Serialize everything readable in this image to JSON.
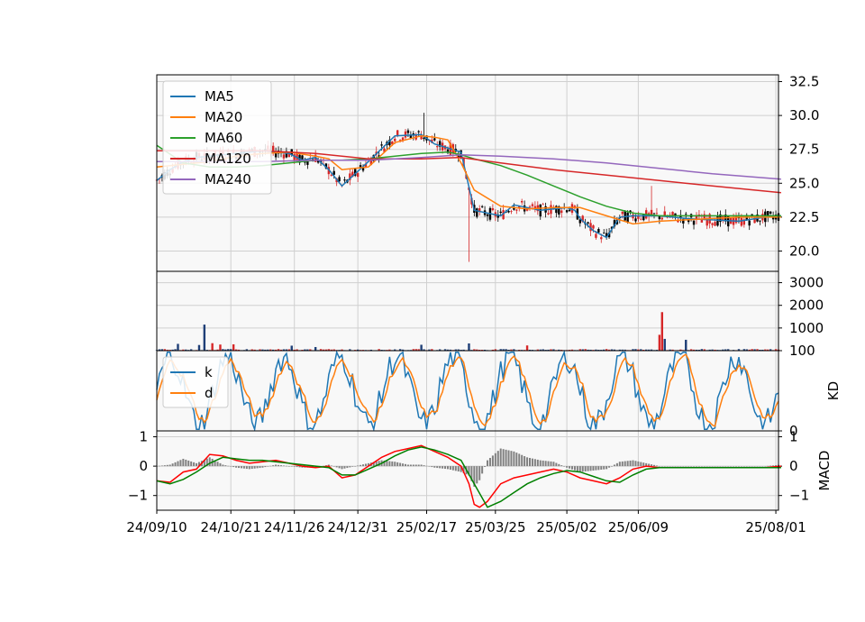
{
  "chart_data": [
    {
      "panel": "price",
      "type": "candlestick+line",
      "y_ticks": [
        "20.0",
        "22.5",
        "25.0",
        "27.5",
        "30.0",
        "32.5"
      ],
      "ylim": [
        18.5,
        33.0
      ],
      "grid": true,
      "legend_position": "top-left",
      "legend": [
        "MA5",
        "MA20",
        "MA60",
        "MA120",
        "MA240"
      ],
      "colors": {
        "MA5": "#1f77b4",
        "MA20": "#ff7f0e",
        "MA60": "#2ca02c",
        "MA120": "#d62728",
        "MA240": "#9467bd",
        "up": "#d62728",
        "down": "#000000"
      },
      "series": [
        {
          "name": "MA5",
          "x": [
            0,
            5,
            10,
            15,
            20,
            25,
            30,
            40,
            50,
            55,
            60,
            65,
            70,
            80,
            90,
            100,
            105,
            110,
            115,
            120,
            130,
            135,
            140,
            145,
            150,
            155,
            158,
            160,
            165,
            170,
            175,
            180,
            190,
            200,
            210,
            220,
            230,
            236
          ],
          "y": [
            25.2,
            26.0,
            26.6,
            26.9,
            27.0,
            27.1,
            27.2,
            27.4,
            27.2,
            26.7,
            26.9,
            26.0,
            24.8,
            26.6,
            28.5,
            28.6,
            27.9,
            27.6,
            27.3,
            23.0,
            22.6,
            23.4,
            23.2,
            23.0,
            23.1,
            23.2,
            23.0,
            22.4,
            21.5,
            21.0,
            22.5,
            22.6,
            22.6,
            22.4,
            22.3,
            22.2,
            22.5,
            22.6
          ]
        },
        {
          "name": "MA20",
          "x": [
            0,
            10,
            20,
            30,
            40,
            50,
            60,
            65,
            70,
            80,
            90,
            100,
            105,
            110,
            115,
            120,
            130,
            140,
            150,
            160,
            170,
            180,
            190,
            200,
            210,
            220,
            230,
            236
          ],
          "y": [
            26.2,
            26.4,
            26.6,
            27.0,
            27.2,
            27.3,
            27.0,
            26.8,
            26.0,
            26.2,
            28.0,
            28.5,
            28.4,
            28.2,
            26.5,
            24.5,
            23.3,
            23.1,
            23.2,
            23.2,
            22.6,
            22.0,
            22.2,
            22.3,
            22.4,
            22.5,
            22.5,
            22.5
          ]
        },
        {
          "name": "MA60",
          "x": [
            0,
            10,
            20,
            30,
            40,
            50,
            60,
            70,
            80,
            90,
            100,
            110,
            115,
            120,
            130,
            140,
            150,
            160,
            170,
            180,
            190,
            200,
            210,
            220,
            230,
            236
          ],
          "y": [
            27.8,
            26.5,
            26.2,
            26.2,
            26.3,
            26.5,
            26.7,
            26.7,
            26.8,
            27.0,
            27.2,
            27.3,
            27.1,
            26.8,
            26.3,
            25.6,
            24.8,
            24.0,
            23.3,
            22.8,
            22.6,
            22.6,
            22.6,
            22.6,
            22.6,
            22.6
          ]
        },
        {
          "name": "MA120",
          "x": [
            0,
            20,
            40,
            60,
            80,
            100,
            115,
            130,
            150,
            170,
            190,
            210,
            236
          ],
          "y": [
            27.4,
            27.4,
            27.4,
            27.2,
            26.8,
            26.8,
            26.9,
            26.5,
            26.0,
            25.6,
            25.2,
            24.8,
            24.3
          ]
        },
        {
          "name": "MA240",
          "x": [
            0,
            20,
            40,
            60,
            80,
            100,
            115,
            130,
            150,
            170,
            190,
            210,
            236
          ],
          "y": [
            26.6,
            26.6,
            26.6,
            26.7,
            26.7,
            26.9,
            27.1,
            27.0,
            26.8,
            26.5,
            26.1,
            25.7,
            25.3
          ]
        }
      ]
    },
    {
      "panel": "volume",
      "type": "bar",
      "y_ticks": [
        "1000",
        "2000",
        "3000"
      ],
      "ylim": [
        0,
        3500
      ],
      "grid": true
    },
    {
      "panel": "kd",
      "type": "line",
      "ylabel": "KD",
      "y_ticks": [
        "0",
        "100"
      ],
      "ylim": [
        0,
        100
      ],
      "grid": true,
      "legend_position": "top-left",
      "legend": [
        "k",
        "d"
      ],
      "colors": {
        "k": "#1f77b4",
        "d": "#ff7f0e"
      }
    },
    {
      "panel": "macd",
      "type": "line+bar",
      "ylabel": "MACD",
      "y_ticks_left": [
        "1",
        "0",
        "−1"
      ],
      "y_ticks_right": [
        "1",
        "0",
        "−1"
      ],
      "ylim": [
        -1.5,
        1.2
      ],
      "grid": true,
      "colors": {
        "dif": "#ff0000",
        "signal": "#008000",
        "hist": "#808080"
      },
      "series": [
        {
          "name": "",
          "color": "#ff0000",
          "x": [
            0,
            5,
            10,
            15,
            20,
            25,
            30,
            35,
            40,
            45,
            50,
            55,
            60,
            65,
            70,
            75,
            80,
            85,
            90,
            95,
            100,
            105,
            110,
            115,
            118,
            120,
            122,
            125,
            130,
            135,
            140,
            145,
            150,
            155,
            160,
            165,
            170,
            175,
            180,
            185,
            190,
            195,
            200,
            205,
            210,
            215,
            220,
            225,
            230,
            236
          ],
          "y": [
            -0.5,
            -0.55,
            -0.2,
            -0.1,
            0.4,
            0.35,
            0.2,
            0.1,
            0.15,
            0.2,
            0.1,
            0.0,
            -0.05,
            0.0,
            -0.4,
            -0.3,
            0.0,
            0.3,
            0.5,
            0.6,
            0.7,
            0.5,
            0.3,
            0.0,
            -0.6,
            -1.3,
            -1.4,
            -1.2,
            -0.6,
            -0.4,
            -0.3,
            -0.2,
            -0.1,
            -0.2,
            -0.4,
            -0.5,
            -0.6,
            -0.4,
            -0.1,
            0.0,
            -0.05,
            -0.05,
            -0.05,
            -0.05,
            -0.05,
            -0.05,
            -0.05,
            -0.05,
            -0.05,
            0.0
          ]
        },
        {
          "name": "",
          "color": "#008000",
          "x": [
            0,
            5,
            10,
            15,
            20,
            25,
            30,
            35,
            40,
            45,
            50,
            55,
            60,
            65,
            70,
            75,
            80,
            85,
            90,
            95,
            100,
            105,
            110,
            115,
            120,
            125,
            130,
            135,
            140,
            145,
            150,
            155,
            160,
            165,
            170,
            175,
            180,
            185,
            190,
            195,
            200,
            205,
            210,
            215,
            220,
            225,
            230,
            236
          ],
          "y": [
            -0.5,
            -0.6,
            -0.45,
            -0.2,
            0.1,
            0.3,
            0.25,
            0.2,
            0.2,
            0.15,
            0.1,
            0.05,
            0.0,
            -0.05,
            -0.3,
            -0.3,
            -0.1,
            0.1,
            0.35,
            0.55,
            0.65,
            0.55,
            0.4,
            0.2,
            -0.6,
            -1.4,
            -1.2,
            -0.9,
            -0.6,
            -0.4,
            -0.25,
            -0.15,
            -0.2,
            -0.35,
            -0.5,
            -0.55,
            -0.3,
            -0.1,
            -0.05,
            -0.05,
            -0.05,
            -0.05,
            -0.05,
            -0.05,
            -0.05,
            -0.05,
            -0.05,
            -0.05
          ]
        }
      ]
    }
  ],
  "x_axis": {
    "tick_labels": [
      "24/09/10",
      "24/10/21",
      "24/11/26",
      "24/12/31",
      "25/02/17",
      "25/03/25",
      "25/05/02",
      "25/06/09",
      "25/08/01"
    ],
    "tick_index": [
      0,
      28,
      52,
      76,
      102,
      128,
      155,
      182,
      234
    ],
    "n_days": 236
  }
}
